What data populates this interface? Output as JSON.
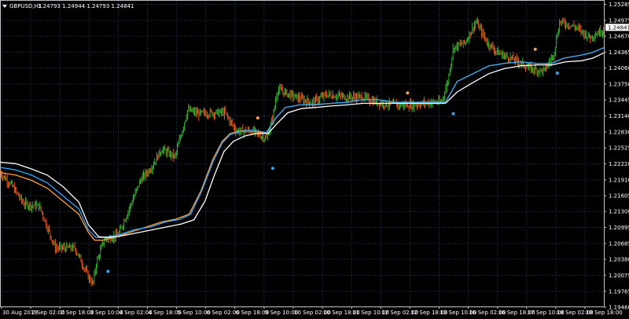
{
  "header": {
    "symbol_label": "GBPUSD,H1",
    "ohlc_label": "1.24793 1.24944 1.24793 1.24841",
    "arrow_icon": "triangle-down-icon"
  },
  "price_tag": "1.24841",
  "colors": {
    "background": "#000000",
    "grid": "#1e3a5f",
    "bull": "#33cc33",
    "bear": "#ff5a1e",
    "ma_fast": "#ffa040",
    "ma_blue": "#2aa8ff",
    "ma_white": "#ffffff",
    "dot_orange": "#ffa040",
    "dot_blue": "#2aa8ff",
    "text": "#ffffff"
  },
  "chart_data": {
    "type": "candlestick",
    "symbol": "GBPUSD",
    "timeframe": "H1",
    "ylim": [
      1.19476,
      1.25352
    ],
    "y_ticks": [
      1.25285,
      1.24975,
      1.2467,
      1.24365,
      1.2406,
      1.2375,
      1.23445,
      1.2314,
      1.2283,
      1.22525,
      1.2222,
      1.2191,
      1.21605,
      1.213,
      1.20995,
      1.20685,
      1.2038,
      1.20075,
      1.19765,
      1.1946
    ],
    "y_tick_labels": [
      "1.25285",
      "1.24975",
      "1.24670",
      "1.24365",
      "1.24060",
      "1.23750",
      "1.23445",
      "1.23140",
      "1.22830",
      "1.22525",
      "1.22220",
      "1.21910",
      "1.21605",
      "1.21300",
      "1.20995",
      "1.20685",
      "1.20380",
      "1.20075",
      "1.19765",
      "1.19460"
    ],
    "x_labels": [
      "30 Aug 2019",
      "2 Sep 02:00",
      "2 Sep 18:00",
      "3 Sep 10:00",
      "4 Sep 02:00",
      "4 Sep 18:00",
      "5 Sep 10:00",
      "6 Sep 02:00",
      "6 Sep 18:00",
      "9 Sep 10:00",
      "10 Sep 02:00",
      "10 Sep 18:00",
      "11 Sep 10:00",
      "12 Sep 02:00",
      "12 Sep 18:00",
      "13 Sep 10:00",
      "16 Sep 02:00",
      "16 Sep 18:00",
      "17 Sep 10:00",
      "18 Sep 02:00",
      "18 Sep 18:00"
    ],
    "price_path": [
      [
        0,
        1.2205
      ],
      [
        15,
        1.218
      ],
      [
        30,
        1.2145
      ],
      [
        50,
        1.214
      ],
      [
        70,
        1.206
      ],
      [
        95,
        1.206
      ],
      [
        112,
        1.2005
      ],
      [
        118,
        1.199
      ],
      [
        122,
        1.203
      ],
      [
        132,
        1.2075
      ],
      [
        150,
        1.2085
      ],
      [
        165,
        1.214
      ],
      [
        178,
        1.219
      ],
      [
        192,
        1.2215
      ],
      [
        205,
        1.225
      ],
      [
        222,
        1.2235
      ],
      [
        238,
        1.2325
      ],
      [
        252,
        1.2318
      ],
      [
        270,
        1.232
      ],
      [
        285,
        1.232
      ],
      [
        300,
        1.2285
      ],
      [
        320,
        1.2285
      ],
      [
        338,
        1.227
      ],
      [
        346,
        1.231
      ],
      [
        352,
        1.2365
      ],
      [
        375,
        1.235
      ],
      [
        395,
        1.234
      ],
      [
        415,
        1.2355
      ],
      [
        440,
        1.235
      ],
      [
        460,
        1.235
      ],
      [
        478,
        1.234
      ],
      [
        500,
        1.2335
      ],
      [
        525,
        1.2335
      ],
      [
        545,
        1.234
      ],
      [
        560,
        1.234
      ],
      [
        568,
        1.238
      ],
      [
        575,
        1.2445
      ],
      [
        590,
        1.2455
      ],
      [
        604,
        1.2495
      ],
      [
        618,
        1.2455
      ],
      [
        632,
        1.2435
      ],
      [
        655,
        1.242
      ],
      [
        672,
        1.2405
      ],
      [
        690,
        1.24
      ],
      [
        702,
        1.243
      ],
      [
        710,
        1.2495
      ],
      [
        730,
        1.2485
      ],
      [
        748,
        1.2465
      ],
      [
        766,
        1.248
      ]
    ],
    "series": [
      {
        "name": "",
        "color": "#ffa040",
        "points": [
          [
            0,
            1.2205
          ],
          [
            20,
            1.22
          ],
          [
            40,
            1.219
          ],
          [
            60,
            1.2175
          ],
          [
            80,
            1.215
          ],
          [
            100,
            1.2125
          ],
          [
            112,
            1.209
          ],
          [
            120,
            1.2075
          ],
          [
            130,
            1.2075
          ],
          [
            145,
            1.208
          ],
          [
            165,
            1.209
          ],
          [
            185,
            1.21
          ],
          [
            205,
            1.211
          ],
          [
            222,
            1.2115
          ],
          [
            240,
            1.2125
          ],
          [
            255,
            1.217
          ],
          [
            270,
            1.223
          ],
          [
            282,
            1.2265
          ],
          [
            292,
            1.228
          ],
          [
            305,
            1.2285
          ],
          [
            322,
            1.2285
          ],
          [
            338,
            1.228
          ],
          [
            350,
            1.231
          ],
          [
            362,
            1.233
          ],
          [
            380,
            1.2335
          ],
          [
            400,
            1.2335
          ],
          [
            420,
            1.2338
          ],
          [
            440,
            1.234
          ],
          [
            460,
            1.2345
          ],
          [
            480,
            1.2345
          ],
          [
            500,
            1.234
          ],
          [
            520,
            1.234
          ],
          [
            545,
            1.234
          ],
          [
            565,
            1.234
          ],
          [
            580,
            1.238
          ],
          [
            600,
            1.2395
          ],
          [
            620,
            1.241
          ],
          [
            640,
            1.2415
          ],
          [
            660,
            1.2418
          ],
          [
            680,
            1.2415
          ],
          [
            700,
            1.2415
          ],
          [
            715,
            1.2425
          ],
          [
            735,
            1.243
          ],
          [
            750,
            1.2435
          ],
          [
            766,
            1.2445
          ]
        ]
      },
      {
        "name": "",
        "color": "#2aa8ff",
        "points": [
          [
            0,
            1.2215
          ],
          [
            20,
            1.221
          ],
          [
            40,
            1.22
          ],
          [
            60,
            1.2185
          ],
          [
            80,
            1.216
          ],
          [
            100,
            1.2135
          ],
          [
            112,
            1.2095
          ],
          [
            122,
            1.208
          ],
          [
            132,
            1.208
          ],
          [
            150,
            1.2085
          ],
          [
            170,
            1.2095
          ],
          [
            190,
            1.21
          ],
          [
            210,
            1.211
          ],
          [
            228,
            1.2115
          ],
          [
            242,
            1.2125
          ],
          [
            256,
            1.217
          ],
          [
            270,
            1.2225
          ],
          [
            282,
            1.2262
          ],
          [
            292,
            1.2278
          ],
          [
            305,
            1.2284
          ],
          [
            322,
            1.2286
          ],
          [
            338,
            1.2282
          ],
          [
            350,
            1.231
          ],
          [
            362,
            1.233
          ],
          [
            380,
            1.2335
          ],
          [
            400,
            1.2336
          ],
          [
            420,
            1.2338
          ],
          [
            440,
            1.234
          ],
          [
            460,
            1.2345
          ],
          [
            480,
            1.2345
          ],
          [
            500,
            1.234
          ],
          [
            520,
            1.234
          ],
          [
            545,
            1.234
          ],
          [
            565,
            1.234
          ],
          [
            580,
            1.238
          ],
          [
            600,
            1.2395
          ],
          [
            620,
            1.241
          ],
          [
            640,
            1.2415
          ],
          [
            660,
            1.2418
          ],
          [
            680,
            1.2415
          ],
          [
            700,
            1.2415
          ],
          [
            715,
            1.2425
          ],
          [
            735,
            1.243
          ],
          [
            750,
            1.2435
          ],
          [
            766,
            1.2445
          ]
        ]
      },
      {
        "name": "",
        "color": "#ffffff",
        "points": [
          [
            0,
            1.2225
          ],
          [
            20,
            1.2222
          ],
          [
            40,
            1.2212
          ],
          [
            60,
            1.22
          ],
          [
            80,
            1.2178
          ],
          [
            100,
            1.2148
          ],
          [
            112,
            1.2105
          ],
          [
            125,
            1.2082
          ],
          [
            135,
            1.208
          ],
          [
            150,
            1.2082
          ],
          [
            170,
            1.2088
          ],
          [
            190,
            1.2094
          ],
          [
            210,
            1.21
          ],
          [
            230,
            1.2106
          ],
          [
            246,
            1.2114
          ],
          [
            260,
            1.215
          ],
          [
            272,
            1.22
          ],
          [
            284,
            1.2245
          ],
          [
            296,
            1.2265
          ],
          [
            310,
            1.2275
          ],
          [
            325,
            1.228
          ],
          [
            340,
            1.228
          ],
          [
            352,
            1.23
          ],
          [
            365,
            1.232
          ],
          [
            382,
            1.2328
          ],
          [
            400,
            1.233
          ],
          [
            420,
            1.2333
          ],
          [
            440,
            1.2335
          ],
          [
            460,
            1.2338
          ],
          [
            480,
            1.2338
          ],
          [
            500,
            1.2338
          ],
          [
            520,
            1.2338
          ],
          [
            545,
            1.2338
          ],
          [
            565,
            1.2338
          ],
          [
            580,
            1.236
          ],
          [
            600,
            1.2378
          ],
          [
            620,
            1.2395
          ],
          [
            640,
            1.2405
          ],
          [
            660,
            1.241
          ],
          [
            680,
            1.2412
          ],
          [
            700,
            1.2412
          ],
          [
            718,
            1.2418
          ],
          [
            738,
            1.242
          ],
          [
            752,
            1.2425
          ],
          [
            766,
            1.2435
          ]
        ]
      }
    ],
    "markers": [
      {
        "x": 137,
        "y": 1.2015,
        "color": "#2aa8ff"
      },
      {
        "x": 327,
        "y": 1.231,
        "color": "#ffa040"
      },
      {
        "x": 346,
        "y": 1.2213,
        "color": "#2aa8ff"
      },
      {
        "x": 517,
        "y": 1.2358,
        "color": "#ffa040"
      },
      {
        "x": 575,
        "y": 1.2318,
        "color": "#2aa8ff"
      },
      {
        "x": 679,
        "y": 1.2442,
        "color": "#ffa040"
      },
      {
        "x": 707,
        "y": 1.2396,
        "color": "#2aa8ff"
      }
    ],
    "grid": true,
    "last_price": 1.24841
  }
}
